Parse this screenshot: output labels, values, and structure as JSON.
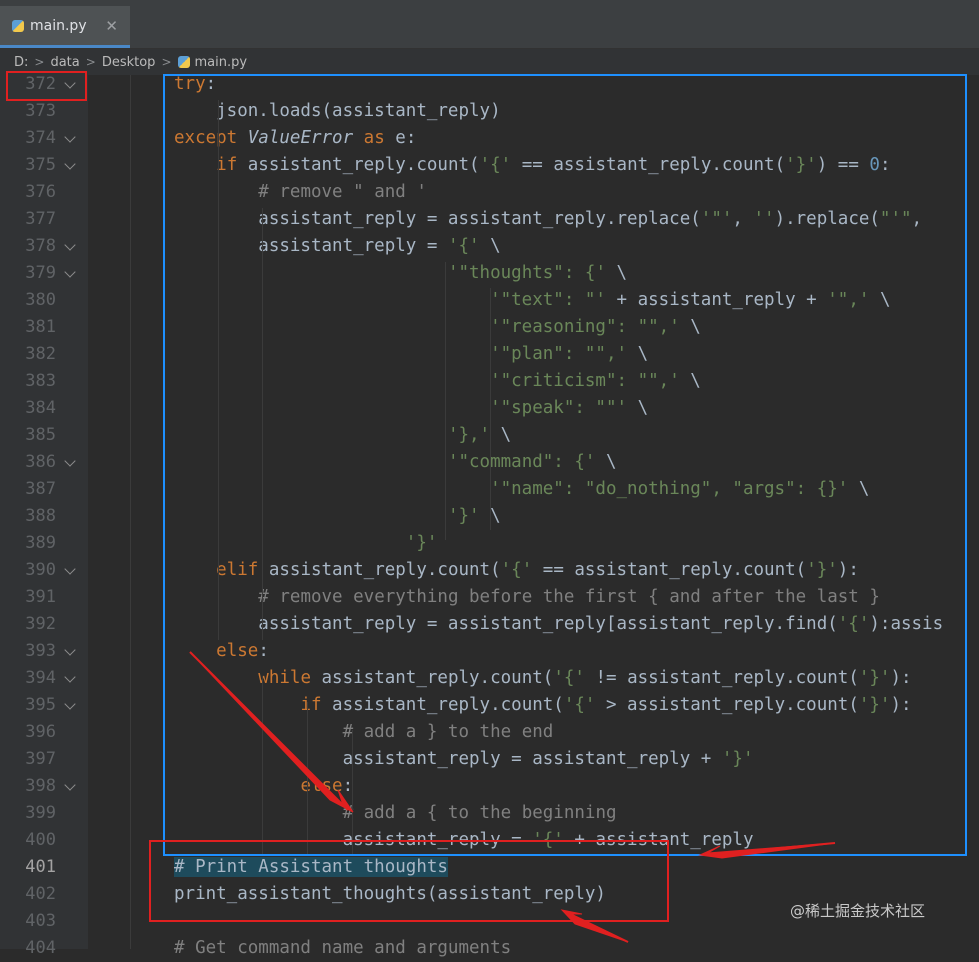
{
  "tab": {
    "label": "main.py",
    "close": "✕"
  },
  "breadcrumb": {
    "parts": [
      "D:",
      "data",
      "Desktop",
      "main.py"
    ]
  },
  "editor": {
    "current_line": "401",
    "lines": [
      {
        "n": "372",
        "fold": true,
        "tokens": [
          [
            "kw",
            "try"
          ],
          [
            "",
            ":"
          ]
        ]
      },
      {
        "n": "373",
        "fold": false,
        "tokens": [
          [
            "",
            "    json.loads(assistant_reply)"
          ]
        ]
      },
      {
        "n": "374",
        "fold": true,
        "tokens": [
          [
            "kw",
            "except "
          ],
          [
            "cls",
            "ValueError"
          ],
          [
            "kw",
            " as "
          ],
          [
            "",
            "e:"
          ]
        ]
      },
      {
        "n": "375",
        "fold": true,
        "tokens": [
          [
            "",
            "    "
          ],
          [
            "kw",
            "if "
          ],
          [
            "",
            "assistant_reply.count("
          ],
          [
            "st",
            "'{'"
          ],
          [
            "",
            " == assistant_reply.count("
          ],
          [
            "st",
            "'}'"
          ],
          [
            "",
            ") == "
          ],
          [
            "nu",
            "0"
          ],
          [
            "",
            ":"
          ]
        ]
      },
      {
        "n": "376",
        "fold": false,
        "tokens": [
          [
            "",
            "        "
          ],
          [
            "cm",
            "# remove \" and '"
          ]
        ]
      },
      {
        "n": "377",
        "fold": false,
        "tokens": [
          [
            "",
            "        assistant_reply = assistant_reply.replace("
          ],
          [
            "st",
            "'\"'"
          ],
          [
            ",",
            ", "
          ],
          [
            "st",
            "''"
          ],
          [
            "",
            ").replace("
          ],
          [
            "st",
            "\"'\""
          ],
          [
            "",
            ","
          ]
        ]
      },
      {
        "n": "378",
        "fold": true,
        "tokens": [
          [
            "",
            "        assistant_reply = "
          ],
          [
            "st",
            "'{'"
          ],
          [
            "",
            " \\"
          ]
        ]
      },
      {
        "n": "379",
        "fold": true,
        "tokens": [
          [
            "",
            "                          "
          ],
          [
            "st",
            "'\"thoughts\": {'"
          ],
          [
            "",
            " \\"
          ]
        ]
      },
      {
        "n": "380",
        "fold": false,
        "tokens": [
          [
            "",
            "                              "
          ],
          [
            "st",
            "'\"text\": \"'"
          ],
          [
            "",
            " + assistant_reply + "
          ],
          [
            "st",
            "'\",'"
          ],
          [
            "",
            " \\"
          ]
        ]
      },
      {
        "n": "381",
        "fold": false,
        "tokens": [
          [
            "",
            "                              "
          ],
          [
            "st",
            "'\"reasoning\": \"\",'"
          ],
          [
            "",
            " \\"
          ]
        ]
      },
      {
        "n": "382",
        "fold": false,
        "tokens": [
          [
            "",
            "                              "
          ],
          [
            "st",
            "'\"plan\": \"\",'"
          ],
          [
            "",
            " \\"
          ]
        ]
      },
      {
        "n": "383",
        "fold": false,
        "tokens": [
          [
            "",
            "                              "
          ],
          [
            "st",
            "'\"criticism\": \"\",'"
          ],
          [
            "",
            " \\"
          ]
        ]
      },
      {
        "n": "384",
        "fold": false,
        "tokens": [
          [
            "",
            "                              "
          ],
          [
            "st",
            "'\"speak\": \"\"'"
          ],
          [
            "",
            " \\"
          ]
        ]
      },
      {
        "n": "385",
        "fold": false,
        "tokens": [
          [
            "",
            "                          "
          ],
          [
            "st",
            "'},'"
          ],
          [
            "",
            " \\"
          ]
        ]
      },
      {
        "n": "386",
        "fold": true,
        "tokens": [
          [
            "",
            "                          "
          ],
          [
            "st",
            "'\"command\": {'"
          ],
          [
            "",
            " \\"
          ]
        ]
      },
      {
        "n": "387",
        "fold": false,
        "tokens": [
          [
            "",
            "                              "
          ],
          [
            "st",
            "'\"name\": \"do_nothing\", \"args\": {}'"
          ],
          [
            "",
            " \\"
          ]
        ]
      },
      {
        "n": "388",
        "fold": false,
        "tokens": [
          [
            "",
            "                          "
          ],
          [
            "st",
            "'}'"
          ],
          [
            "",
            " \\"
          ]
        ]
      },
      {
        "n": "389",
        "fold": false,
        "tokens": [
          [
            "",
            "                      "
          ],
          [
            "st",
            "'}'"
          ]
        ]
      },
      {
        "n": "390",
        "fold": true,
        "tokens": [
          [
            "",
            "    "
          ],
          [
            "kw",
            "elif "
          ],
          [
            "",
            "assistant_reply.count("
          ],
          [
            "st",
            "'{'"
          ],
          [
            "",
            " == assistant_reply.count("
          ],
          [
            "st",
            "'}'"
          ],
          [
            "",
            "):"
          ]
        ]
      },
      {
        "n": "391",
        "fold": false,
        "tokens": [
          [
            "",
            "        "
          ],
          [
            "cm",
            "# remove everything before the first { and after the last }"
          ]
        ]
      },
      {
        "n": "392",
        "fold": false,
        "tokens": [
          [
            "",
            "        assistant_reply = assistant_reply[assistant_reply.find("
          ],
          [
            "st",
            "'{'"
          ],
          [
            "",
            "):assis"
          ]
        ]
      },
      {
        "n": "393",
        "fold": true,
        "tokens": [
          [
            "",
            "    "
          ],
          [
            "kw",
            "else"
          ],
          [
            "",
            ":"
          ]
        ]
      },
      {
        "n": "394",
        "fold": true,
        "tokens": [
          [
            "",
            "        "
          ],
          [
            "kw",
            "while "
          ],
          [
            "",
            "assistant_reply.count("
          ],
          [
            "st",
            "'{'"
          ],
          [
            "",
            " != assistant_reply.count("
          ],
          [
            "st",
            "'}'"
          ],
          [
            "",
            "):"
          ]
        ]
      },
      {
        "n": "395",
        "fold": true,
        "tokens": [
          [
            "",
            "            "
          ],
          [
            "kw",
            "if "
          ],
          [
            "",
            "assistant_reply.count("
          ],
          [
            "st",
            "'{'"
          ],
          [
            "",
            " > assistant_reply.count("
          ],
          [
            "st",
            "'}'"
          ],
          [
            "",
            "):"
          ]
        ]
      },
      {
        "n": "396",
        "fold": false,
        "tokens": [
          [
            "",
            "                "
          ],
          [
            "cm",
            "# add a } to the end"
          ]
        ]
      },
      {
        "n": "397",
        "fold": false,
        "tokens": [
          [
            "",
            "                assistant_reply = assistant_reply + "
          ],
          [
            "st",
            "'}'"
          ]
        ]
      },
      {
        "n": "398",
        "fold": true,
        "tokens": [
          [
            "",
            "            "
          ],
          [
            "kw",
            "else"
          ],
          [
            "",
            ":"
          ]
        ]
      },
      {
        "n": "399",
        "fold": false,
        "tokens": [
          [
            "",
            "                "
          ],
          [
            "cm",
            "# add a { to the beginning"
          ]
        ]
      },
      {
        "n": "400",
        "fold": false,
        "tokens": [
          [
            "",
            "                assistant_reply = "
          ],
          [
            "st",
            "'{'"
          ],
          [
            "",
            " + assistant_reply"
          ]
        ]
      },
      {
        "n": "401",
        "fold": false,
        "tokens": [
          [
            "sel",
            "# Print Assistant thoughts"
          ]
        ]
      },
      {
        "n": "402",
        "fold": false,
        "tokens": [
          [
            "",
            "print_assistant_thoughts(assistant_reply)"
          ]
        ]
      },
      {
        "n": "403",
        "fold": false,
        "tokens": []
      },
      {
        "n": "404",
        "fold": false,
        "tokens": [
          [
            "cm",
            "# Get command name and arguments"
          ]
        ]
      }
    ]
  },
  "annotations": {
    "colors": {
      "blue": "#1e90ff",
      "red": "#e02020"
    }
  },
  "watermark": "@稀土掘金技术社区"
}
